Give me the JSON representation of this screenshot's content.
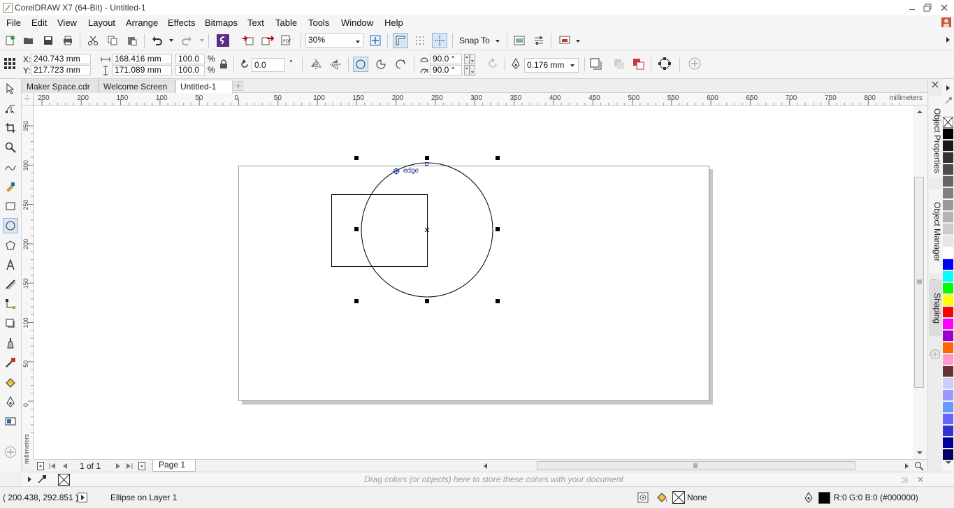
{
  "window": {
    "title": "CorelDRAW X7 (64-Bit) - Untitled-1",
    "controls": [
      "minimize-icon",
      "restore-icon",
      "close-icon"
    ]
  },
  "menu": [
    "File",
    "Edit",
    "View",
    "Layout",
    "Arrange",
    "Effects",
    "Bitmaps",
    "Text",
    "Table",
    "Tools",
    "Window",
    "Help"
  ],
  "toolbar": {
    "zoom_value": "30%",
    "snap_label": "Snap To",
    "icons": [
      "new-icon",
      "open-icon",
      "save-icon",
      "print-icon",
      "cut-icon",
      "copy-icon",
      "paste-icon",
      "undo-icon",
      "redo-icon",
      "corel-connect-icon",
      "import-icon",
      "export-icon",
      "publish-pdf-icon",
      "zoom-icon",
      "rulers-icon",
      "grid-icon",
      "guidelines-icon",
      "welcome-icon",
      "options-icon",
      "application-launcher-icon"
    ]
  },
  "property_bar": {
    "x_label": "X:",
    "x_value": "240.743 mm",
    "y_label": "Y:",
    "y_value": "217.723 mm",
    "width_value": "168.416 mm",
    "height_value": "171.089 mm",
    "scale_x": "100.0",
    "scale_y": "100.0",
    "percent": "%",
    "rotation_value": "0.0",
    "degree": "°",
    "start_angle": "90.0 °",
    "end_angle": "90.0 °",
    "outline_width": "0.176 mm"
  },
  "tools": [
    "pick-tool-icon",
    "shape-tool-icon",
    "crop-tool-icon",
    "zoom-tool-icon",
    "freehand-tool-icon",
    "smart-fill-icon",
    "rectangle-tool-icon",
    "ellipse-tool-icon",
    "polygon-tool-icon",
    "text-tool-icon",
    "parallel-dimension-icon",
    "connector-tool-icon",
    "drop-shadow-icon",
    "transparency-tool-icon",
    "eyedropper-icon",
    "interactive-fill-icon",
    "smart-fill-tool-icon",
    "outline-pen-icon",
    "add-tool-icon"
  ],
  "doc_tabs": [
    {
      "label": "Maker Space.cdr",
      "active": false
    },
    {
      "label": "Welcome Screen",
      "active": false
    },
    {
      "label": "Untitled-1",
      "active": true
    }
  ],
  "rulers": {
    "h_ticks": [
      "250",
      "200",
      "150",
      "100",
      "50",
      "0",
      "50",
      "100",
      "150",
      "200",
      "250",
      "300",
      "350",
      "400",
      "450",
      "500",
      "550",
      "600",
      "650",
      "700",
      "750",
      "800"
    ],
    "h_unit": "millimeters",
    "v_ticks": [
      "350",
      "300",
      "250",
      "200",
      "150",
      "100",
      "50",
      "0"
    ],
    "v_unit": "millimeters"
  },
  "canvas": {
    "snap_hint": "edge"
  },
  "page_nav": {
    "page_count": "1 of 1",
    "page_tab": "Page 1"
  },
  "dockers": [
    "Object Properties",
    "Object Manager",
    "Shaping"
  ],
  "palette": {
    "colors": [
      "#000000",
      "#1a1a1a",
      "#333333",
      "#4d4d4d",
      "#666666",
      "#808080",
      "#999999",
      "#b3b3b3",
      "#cccccc",
      "#e6e6e6",
      "#ffffff",
      "#0000ff",
      "#00ffff",
      "#00ff00",
      "#ffff00",
      "#ff0000",
      "#ff00ff",
      "#9900cc",
      "#ff6600",
      "#ff99cc",
      "#663333",
      "#ccccff",
      "#9999ff",
      "#6699ff",
      "#6666ff",
      "#3333cc",
      "#000099",
      "#000066"
    ]
  },
  "color_tray": {
    "hint": "Drag colors (or objects) here to store these colors with your document"
  },
  "status": {
    "coords": "( 200.438, 292.851 )",
    "selection": "Ellipse on Layer 1",
    "fill_label": "None",
    "outline_label": "R:0 G:0 B:0 (#000000)"
  }
}
